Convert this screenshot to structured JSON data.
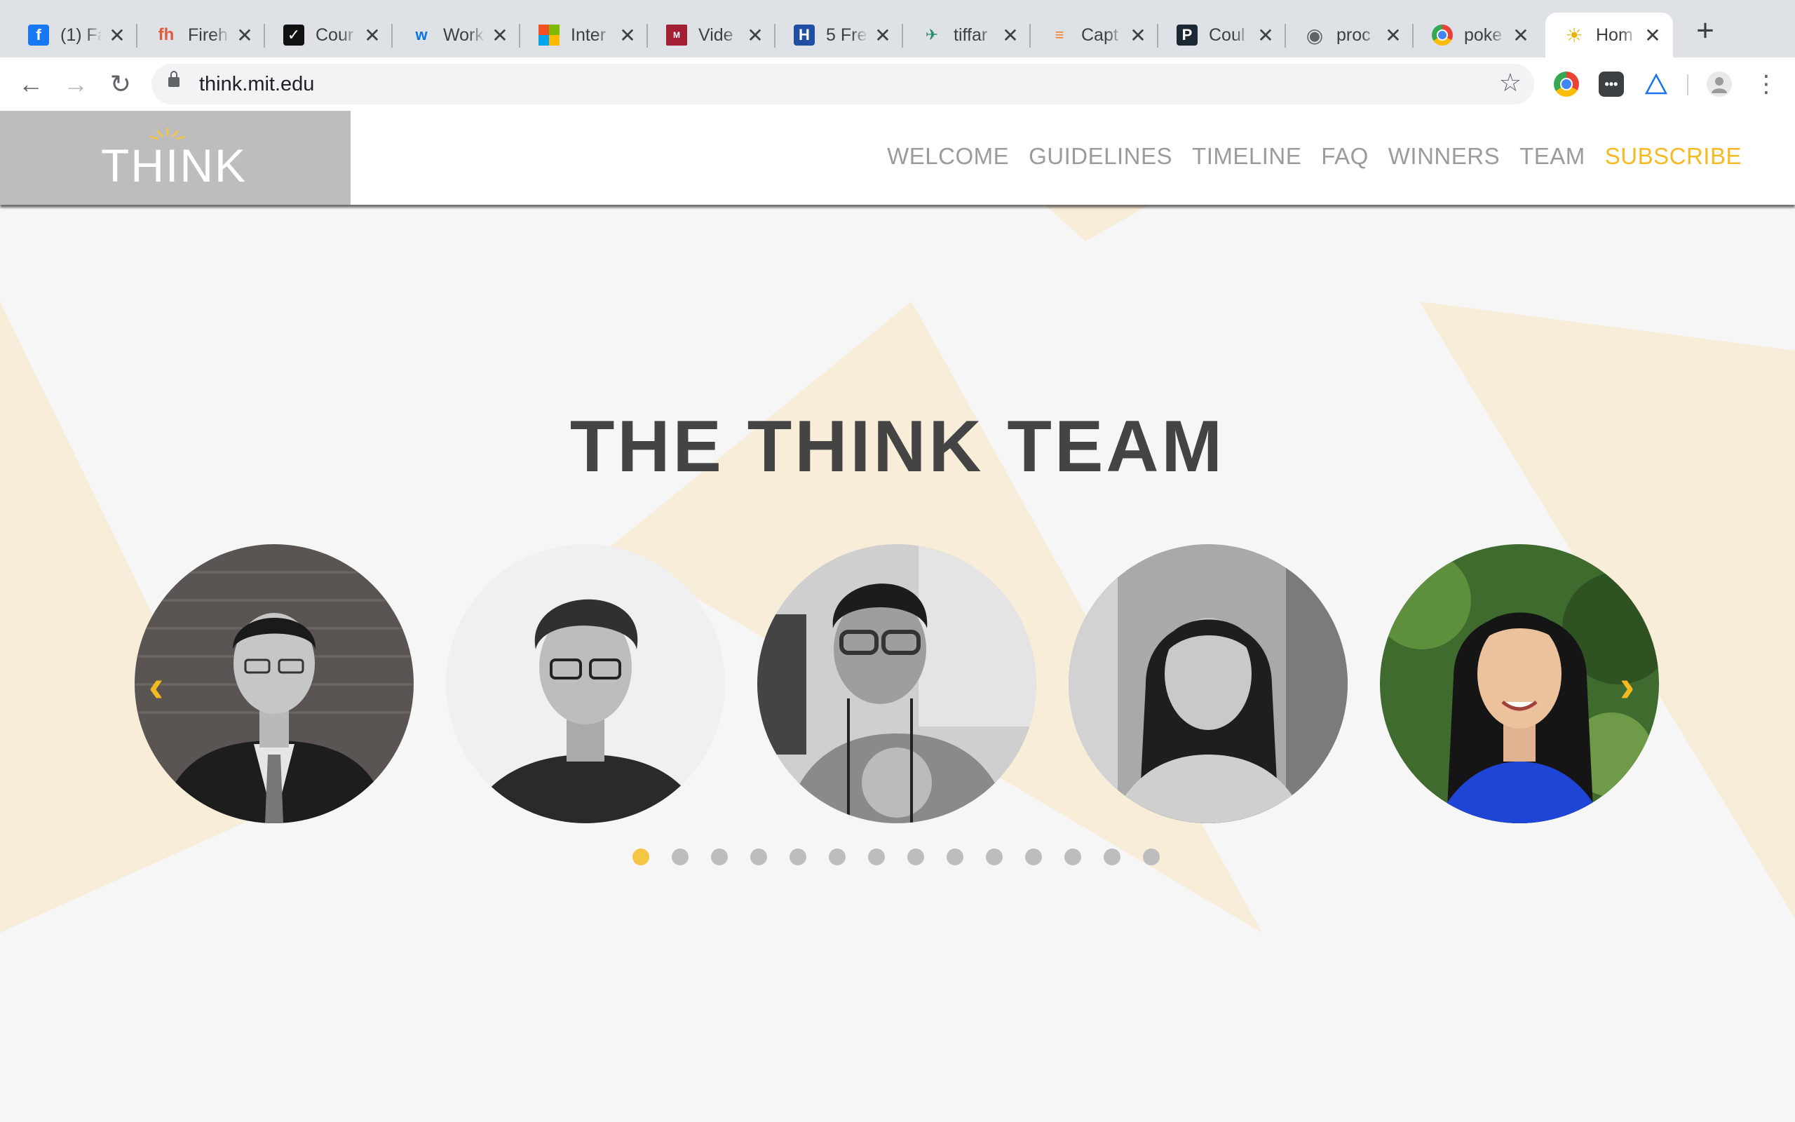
{
  "browser": {
    "tabs": [
      {
        "title": "(1) Fa",
        "icon": "facebook-icon",
        "color": "#1877f2",
        "glyph": "f"
      },
      {
        "title": "Fireh",
        "icon": "firehose-icon",
        "color": "#e25a3d",
        "glyph": "fh"
      },
      {
        "title": "Cour",
        "icon": "checkbox-icon",
        "color": "#111111",
        "glyph": "✓"
      },
      {
        "title": "Work",
        "icon": "workday-icon",
        "color": "#f5a623",
        "glyph": "w"
      },
      {
        "title": "Inter",
        "icon": "microsoft-icon",
        "color": "#7fba00",
        "glyph": "■"
      },
      {
        "title": "Vide",
        "icon": "mit-ocw-icon",
        "color": "#a31f34",
        "glyph": "M"
      },
      {
        "title": "5 Fre",
        "icon": "hotel-icon",
        "color": "#1f4ea3",
        "glyph": "H"
      },
      {
        "title": "tiffar",
        "icon": "bird-icon",
        "color": "#2a8c6e",
        "glyph": "✈"
      },
      {
        "title": "Capt",
        "icon": "stack-icon",
        "color": "#f48024",
        "glyph": "≡"
      },
      {
        "title": "Coul",
        "icon": "p-icon",
        "color": "#1c2833",
        "glyph": "P"
      },
      {
        "title": "proc",
        "icon": "globe-icon",
        "color": "#5f6368",
        "glyph": "◉"
      },
      {
        "title": "poke",
        "icon": "chrome-icon",
        "color": "#34a853",
        "glyph": "◎"
      },
      {
        "title": "Hom",
        "icon": "lightbulb-icon",
        "color": "#f5c544",
        "glyph": "☀",
        "active": true
      }
    ],
    "tab_close": "✕",
    "new_tab": "+",
    "back": "←",
    "forward": "→",
    "reload": "↻",
    "url": "think.mit.edu",
    "bookmark": "☆",
    "menu": "⋮",
    "extensions": [
      "chrome-ext-icon",
      "dots-ext-icon",
      "triangle-ext-icon",
      "profile-ext-icon"
    ]
  },
  "site": {
    "logo": "THINK",
    "nav": [
      "WELCOME",
      "GUIDELINES",
      "TIMELINE",
      "FAQ",
      "WINNERS",
      "TEAM"
    ],
    "subscribe": "SUBSCRIBE",
    "accent": "#f5b921"
  },
  "team": {
    "title": "THE THINK TEAM",
    "prev_arrow": "‹",
    "next_arrow": "›",
    "slides_total": 14,
    "active_slide": 1
  }
}
